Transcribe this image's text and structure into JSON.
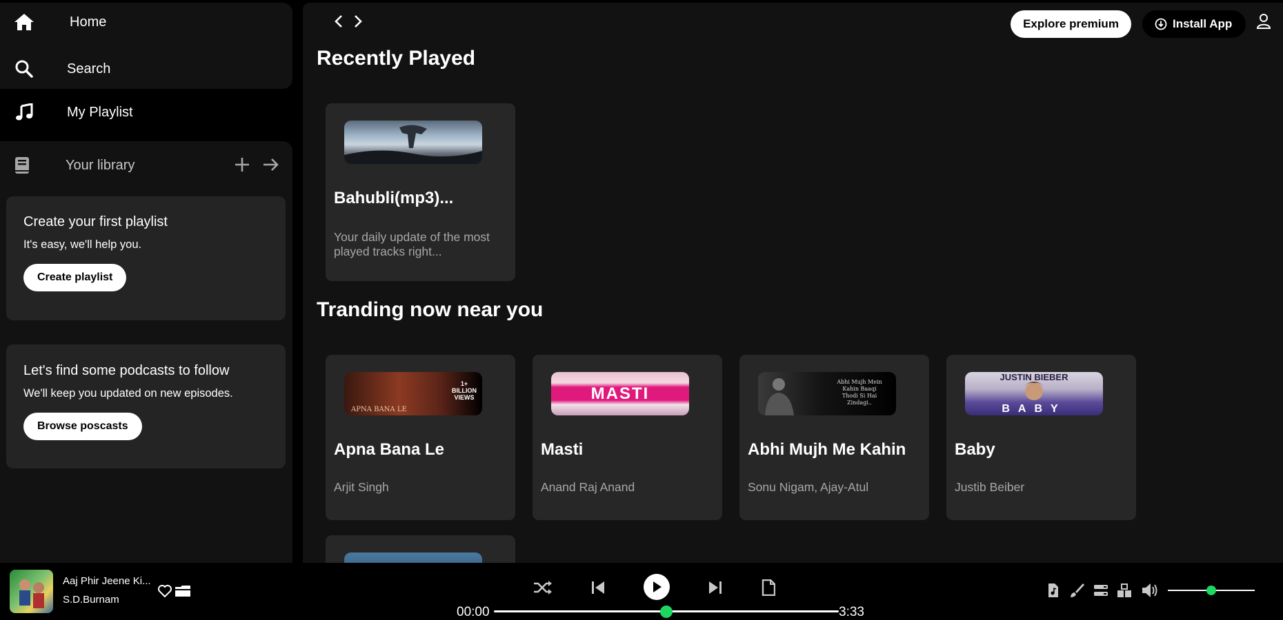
{
  "sidebar": {
    "nav": {
      "home": "Home",
      "search": "Search",
      "playlist": "My Playlist"
    },
    "library": {
      "label": "Your library"
    },
    "promo_playlist": {
      "title": "Create your first playlist",
      "text": "It's easy, we'll help you.",
      "button": "Create playlist"
    },
    "promo_podcasts": {
      "title": "Let's find some podcasts to follow",
      "text": "We'll keep you updated on new episodes.",
      "button": "Browse poscasts"
    }
  },
  "topbar": {
    "premium": "Explore premium",
    "install": "Install App"
  },
  "main": {
    "recent_heading": "Recently Played",
    "recent": [
      {
        "title": "Bahubli(mp3)...",
        "subtitle": "Your daily update of the most played tracks right..."
      }
    ],
    "trending_heading": "Tranding now near you",
    "trending": [
      {
        "title": "Apna Bana Le",
        "subtitle": "Arjit Singh",
        "thumb_text": "APNA BANA LE",
        "badge": "1+ BILLION VIEWS"
      },
      {
        "title": "Masti",
        "subtitle": "Anand Raj Anand",
        "thumb_text": "MASTI"
      },
      {
        "title": "Abhi Mujh Me Kahin",
        "subtitle": "Sonu Nigam, Ajay-Atul",
        "thumb_text": "Abhi Mujh Mein Kahin Baaqi Thodi Si Hai Zindagi.."
      },
      {
        "title": "Baby",
        "subtitle": "Justib Beiber",
        "thumb_text_top": "JUSTIN BIEBER",
        "thumb_text": "BABY"
      }
    ]
  },
  "player": {
    "track": "Aaj Phir Jeene Ki...",
    "artist": "S.D.Burnam",
    "elapsed": "00:00",
    "duration": "3:33",
    "progress": 0.5,
    "volume": 0.5,
    "accent": "#1ed760"
  },
  "colors": {
    "background": "#000000",
    "panel": "#121212",
    "card": "#272727",
    "muted": "#a7a7a7"
  }
}
